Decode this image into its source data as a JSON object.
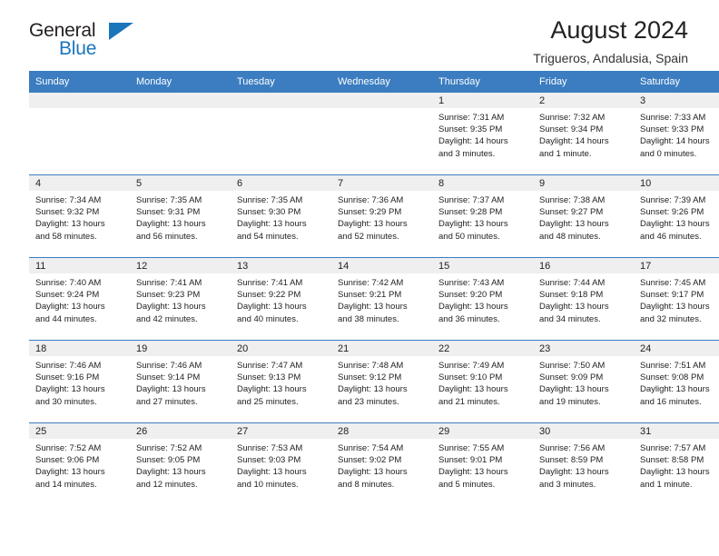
{
  "logo": {
    "word_general": "General",
    "word_blue": "Blue",
    "triangle_color": "#1b75bb"
  },
  "header": {
    "title": "August 2024",
    "subtitle": "Trigueros, Andalusia, Spain"
  },
  "theme": {
    "header_blue": "#3b7dc0",
    "daynum_gray": "#efefef",
    "text": "#222222"
  },
  "weekday_headers": [
    "Sunday",
    "Monday",
    "Tuesday",
    "Wednesday",
    "Thursday",
    "Friday",
    "Saturday"
  ],
  "weeks": [
    [
      {
        "day": "",
        "empty": true,
        "sunrise": "",
        "sunset": "",
        "daylight1": "",
        "daylight2": ""
      },
      {
        "day": "",
        "empty": true,
        "sunrise": "",
        "sunset": "",
        "daylight1": "",
        "daylight2": ""
      },
      {
        "day": "",
        "empty": true,
        "sunrise": "",
        "sunset": "",
        "daylight1": "",
        "daylight2": ""
      },
      {
        "day": "",
        "empty": true,
        "sunrise": "",
        "sunset": "",
        "daylight1": "",
        "daylight2": ""
      },
      {
        "day": "1",
        "sunrise": "Sunrise: 7:31 AM",
        "sunset": "Sunset: 9:35 PM",
        "daylight1": "Daylight: 14 hours",
        "daylight2": "and 3 minutes."
      },
      {
        "day": "2",
        "sunrise": "Sunrise: 7:32 AM",
        "sunset": "Sunset: 9:34 PM",
        "daylight1": "Daylight: 14 hours",
        "daylight2": "and 1 minute."
      },
      {
        "day": "3",
        "sunrise": "Sunrise: 7:33 AM",
        "sunset": "Sunset: 9:33 PM",
        "daylight1": "Daylight: 14 hours",
        "daylight2": "and 0 minutes."
      }
    ],
    [
      {
        "day": "4",
        "sunrise": "Sunrise: 7:34 AM",
        "sunset": "Sunset: 9:32 PM",
        "daylight1": "Daylight: 13 hours",
        "daylight2": "and 58 minutes."
      },
      {
        "day": "5",
        "sunrise": "Sunrise: 7:35 AM",
        "sunset": "Sunset: 9:31 PM",
        "daylight1": "Daylight: 13 hours",
        "daylight2": "and 56 minutes."
      },
      {
        "day": "6",
        "sunrise": "Sunrise: 7:35 AM",
        "sunset": "Sunset: 9:30 PM",
        "daylight1": "Daylight: 13 hours",
        "daylight2": "and 54 minutes."
      },
      {
        "day": "7",
        "sunrise": "Sunrise: 7:36 AM",
        "sunset": "Sunset: 9:29 PM",
        "daylight1": "Daylight: 13 hours",
        "daylight2": "and 52 minutes."
      },
      {
        "day": "8",
        "sunrise": "Sunrise: 7:37 AM",
        "sunset": "Sunset: 9:28 PM",
        "daylight1": "Daylight: 13 hours",
        "daylight2": "and 50 minutes."
      },
      {
        "day": "9",
        "sunrise": "Sunrise: 7:38 AM",
        "sunset": "Sunset: 9:27 PM",
        "daylight1": "Daylight: 13 hours",
        "daylight2": "and 48 minutes."
      },
      {
        "day": "10",
        "sunrise": "Sunrise: 7:39 AM",
        "sunset": "Sunset: 9:26 PM",
        "daylight1": "Daylight: 13 hours",
        "daylight2": "and 46 minutes."
      }
    ],
    [
      {
        "day": "11",
        "sunrise": "Sunrise: 7:40 AM",
        "sunset": "Sunset: 9:24 PM",
        "daylight1": "Daylight: 13 hours",
        "daylight2": "and 44 minutes."
      },
      {
        "day": "12",
        "sunrise": "Sunrise: 7:41 AM",
        "sunset": "Sunset: 9:23 PM",
        "daylight1": "Daylight: 13 hours",
        "daylight2": "and 42 minutes."
      },
      {
        "day": "13",
        "sunrise": "Sunrise: 7:41 AM",
        "sunset": "Sunset: 9:22 PM",
        "daylight1": "Daylight: 13 hours",
        "daylight2": "and 40 minutes."
      },
      {
        "day": "14",
        "sunrise": "Sunrise: 7:42 AM",
        "sunset": "Sunset: 9:21 PM",
        "daylight1": "Daylight: 13 hours",
        "daylight2": "and 38 minutes."
      },
      {
        "day": "15",
        "sunrise": "Sunrise: 7:43 AM",
        "sunset": "Sunset: 9:20 PM",
        "daylight1": "Daylight: 13 hours",
        "daylight2": "and 36 minutes."
      },
      {
        "day": "16",
        "sunrise": "Sunrise: 7:44 AM",
        "sunset": "Sunset: 9:18 PM",
        "daylight1": "Daylight: 13 hours",
        "daylight2": "and 34 minutes."
      },
      {
        "day": "17",
        "sunrise": "Sunrise: 7:45 AM",
        "sunset": "Sunset: 9:17 PM",
        "daylight1": "Daylight: 13 hours",
        "daylight2": "and 32 minutes."
      }
    ],
    [
      {
        "day": "18",
        "sunrise": "Sunrise: 7:46 AM",
        "sunset": "Sunset: 9:16 PM",
        "daylight1": "Daylight: 13 hours",
        "daylight2": "and 30 minutes."
      },
      {
        "day": "19",
        "sunrise": "Sunrise: 7:46 AM",
        "sunset": "Sunset: 9:14 PM",
        "daylight1": "Daylight: 13 hours",
        "daylight2": "and 27 minutes."
      },
      {
        "day": "20",
        "sunrise": "Sunrise: 7:47 AM",
        "sunset": "Sunset: 9:13 PM",
        "daylight1": "Daylight: 13 hours",
        "daylight2": "and 25 minutes."
      },
      {
        "day": "21",
        "sunrise": "Sunrise: 7:48 AM",
        "sunset": "Sunset: 9:12 PM",
        "daylight1": "Daylight: 13 hours",
        "daylight2": "and 23 minutes."
      },
      {
        "day": "22",
        "sunrise": "Sunrise: 7:49 AM",
        "sunset": "Sunset: 9:10 PM",
        "daylight1": "Daylight: 13 hours",
        "daylight2": "and 21 minutes."
      },
      {
        "day": "23",
        "sunrise": "Sunrise: 7:50 AM",
        "sunset": "Sunset: 9:09 PM",
        "daylight1": "Daylight: 13 hours",
        "daylight2": "and 19 minutes."
      },
      {
        "day": "24",
        "sunrise": "Sunrise: 7:51 AM",
        "sunset": "Sunset: 9:08 PM",
        "daylight1": "Daylight: 13 hours",
        "daylight2": "and 16 minutes."
      }
    ],
    [
      {
        "day": "25",
        "sunrise": "Sunrise: 7:52 AM",
        "sunset": "Sunset: 9:06 PM",
        "daylight1": "Daylight: 13 hours",
        "daylight2": "and 14 minutes."
      },
      {
        "day": "26",
        "sunrise": "Sunrise: 7:52 AM",
        "sunset": "Sunset: 9:05 PM",
        "daylight1": "Daylight: 13 hours",
        "daylight2": "and 12 minutes."
      },
      {
        "day": "27",
        "sunrise": "Sunrise: 7:53 AM",
        "sunset": "Sunset: 9:03 PM",
        "daylight1": "Daylight: 13 hours",
        "daylight2": "and 10 minutes."
      },
      {
        "day": "28",
        "sunrise": "Sunrise: 7:54 AM",
        "sunset": "Sunset: 9:02 PM",
        "daylight1": "Daylight: 13 hours",
        "daylight2": "and 8 minutes."
      },
      {
        "day": "29",
        "sunrise": "Sunrise: 7:55 AM",
        "sunset": "Sunset: 9:01 PM",
        "daylight1": "Daylight: 13 hours",
        "daylight2": "and 5 minutes."
      },
      {
        "day": "30",
        "sunrise": "Sunrise: 7:56 AM",
        "sunset": "Sunset: 8:59 PM",
        "daylight1": "Daylight: 13 hours",
        "daylight2": "and 3 minutes."
      },
      {
        "day": "31",
        "sunrise": "Sunrise: 7:57 AM",
        "sunset": "Sunset: 8:58 PM",
        "daylight1": "Daylight: 13 hours",
        "daylight2": "and 1 minute."
      }
    ]
  ]
}
